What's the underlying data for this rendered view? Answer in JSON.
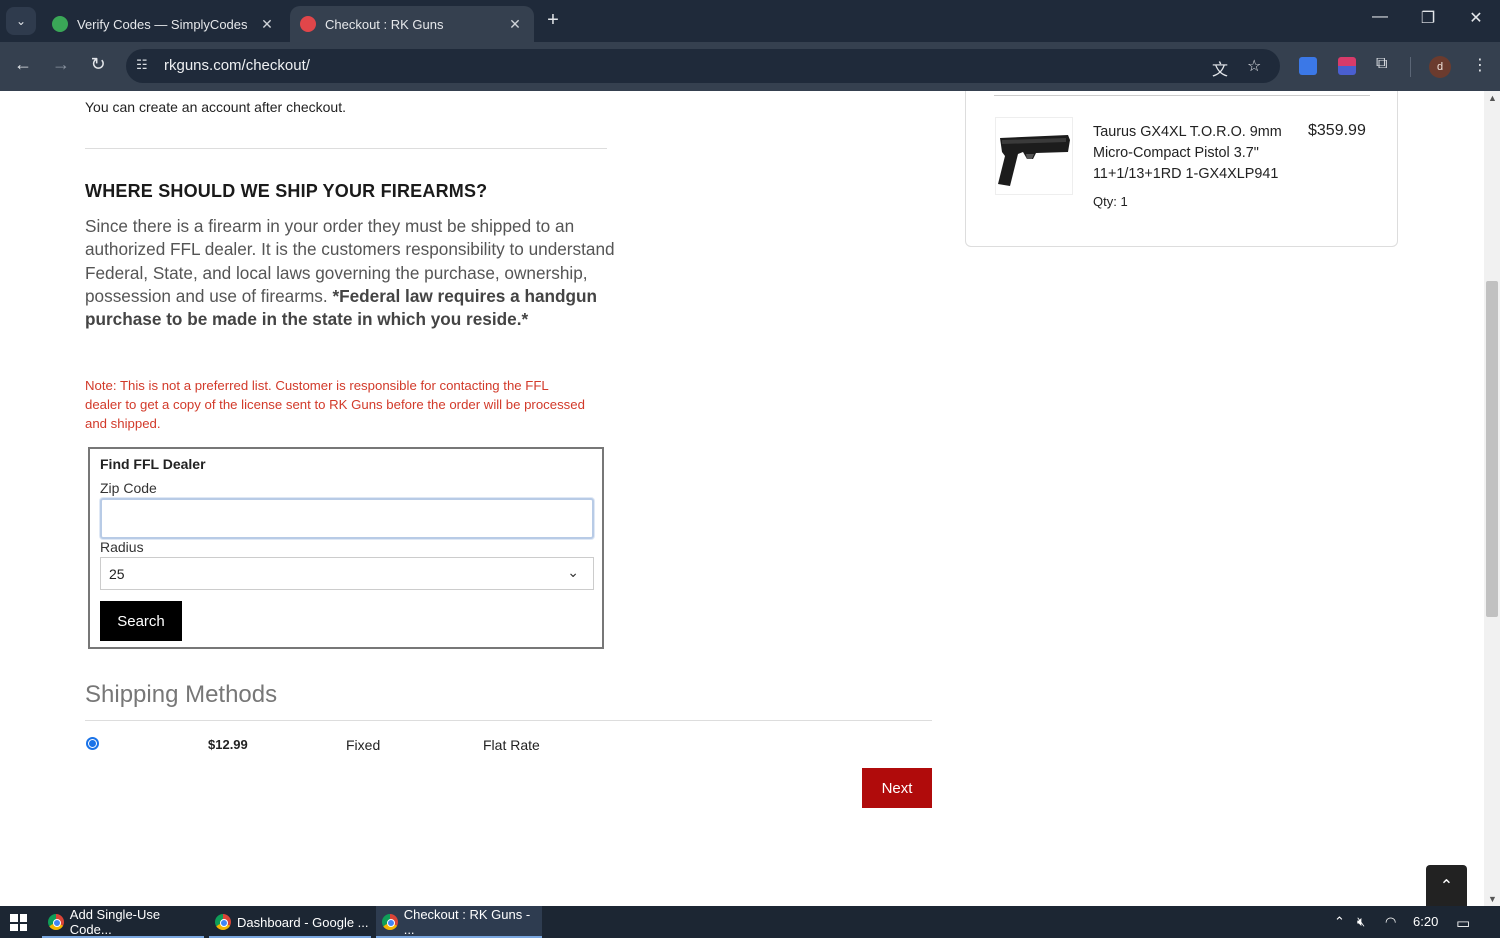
{
  "browser": {
    "tabs": [
      {
        "title": "Verify Codes — SimplyCodes",
        "favicon_color": "#3aa757",
        "active": false
      },
      {
        "title": "Checkout : RK Guns",
        "favicon_color": "#e0464a",
        "active": true
      }
    ],
    "url": "rkguns.com/checkout/",
    "profile_initial": "d"
  },
  "page": {
    "account_note": "You can create an account after checkout.",
    "ship_heading": "WHERE SHOULD WE SHIP YOUR FIREARMS?",
    "ship_paragraph_plain": "Since there is a firearm in your order they must be shipped to an authorized FFL dealer. It is the customers responsibility to understand Federal, State, and local laws governing the purchase, ownership, possession and use of firearms. ",
    "ship_paragraph_bold": "*Federal law requires a handgun purchase to be made in the state in which you reside.*",
    "note": "Note: This is not a preferred list. Customer is responsible for contacting the FFL dealer to get a copy of the license sent to RK Guns before the order will be processed and shipped.",
    "ffl": {
      "title": "Find FFL Dealer",
      "zip_label": "Zip Code",
      "zip_value": "",
      "radius_label": "Radius",
      "radius_value": "25",
      "search_label": "Search"
    },
    "shipping": {
      "heading": "Shipping Methods",
      "methods": [
        {
          "price": "$12.99",
          "type": "Fixed",
          "name": "Flat Rate",
          "selected": true
        }
      ],
      "next_label": "Next"
    },
    "summary": {
      "product_name": "Taurus GX4XL T.O.R.O. 9mm Micro-Compact Pistol 3.7\" 11+1/13+1RD 1-GX4XLP941",
      "price": "$359.99",
      "qty": "Qty: 1"
    },
    "accent_color": "#b00b0b",
    "note_color": "#d23a2a"
  },
  "taskbar": {
    "items": [
      {
        "label": "Add Single-Use Code..."
      },
      {
        "label": "Dashboard - Google ..."
      },
      {
        "label": "Checkout : RK Guns - ..."
      }
    ],
    "time": "6:20"
  }
}
